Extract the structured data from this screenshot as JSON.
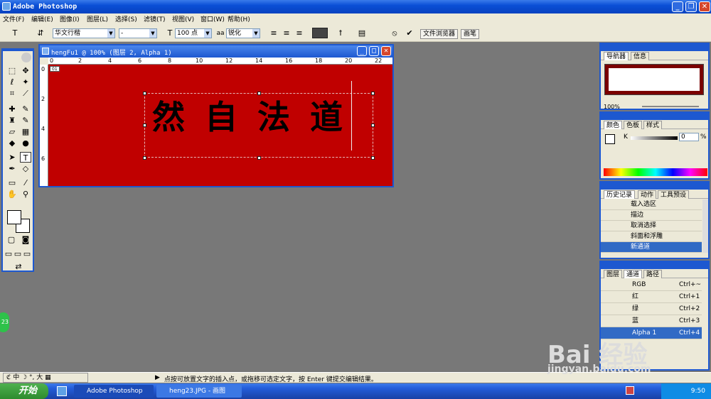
{
  "app": {
    "title": "Adobe Photoshop"
  },
  "menu": [
    "文件(F)",
    "编辑(E)",
    "图像(I)",
    "图层(L)",
    "选择(S)",
    "滤镜(T)",
    "视图(V)",
    "窗口(W)",
    "帮助(H)"
  ],
  "options": {
    "font_family": "华文行楷",
    "font_style": "-",
    "font_size": "100 点",
    "antialias_label": "aa",
    "antialias": "锐化",
    "wells": [
      "文件浏览器",
      "画笔"
    ]
  },
  "document": {
    "title": "hengFu1 @ 100% (图层 2, Alpha 1)",
    "tag": "01",
    "text": "然自法道",
    "ruler_h": [
      "0",
      "2",
      "4",
      "6",
      "8",
      "10",
      "12",
      "14",
      "16",
      "18",
      "20",
      "22"
    ],
    "ruler_v": [
      "0",
      "2",
      "4",
      "6"
    ]
  },
  "navigator": {
    "tabs": [
      "导航器",
      "信息"
    ],
    "zoom": "100%"
  },
  "color": {
    "tabs": [
      "颜色",
      "色板",
      "样式"
    ],
    "channel": "K",
    "value": "0",
    "unit": "%"
  },
  "history": {
    "tabs": [
      "历史记录",
      "动作",
      "工具预设"
    ],
    "items": [
      {
        "label": "载入选区"
      },
      {
        "label": "描边"
      },
      {
        "label": "取消选择"
      },
      {
        "label": "斜面和浮雕"
      },
      {
        "label": "新通道"
      }
    ]
  },
  "channels": {
    "tabs": [
      "图层",
      "通道",
      "路径"
    ],
    "items": [
      {
        "name": "RGB",
        "shortcut": "Ctrl+~"
      },
      {
        "name": "红",
        "shortcut": "Ctrl+1"
      },
      {
        "name": "绿",
        "shortcut": "Ctrl+2"
      },
      {
        "name": "蓝",
        "shortcut": "Ctrl+3"
      },
      {
        "name": "Alpha 1",
        "shortcut": "Ctrl+4"
      }
    ]
  },
  "status": {
    "text": "点按可放置文字的插入点，或拖移可选定文字，按 Enter 键提交编辑结果。",
    "ime": "中",
    "ime_extra": "大",
    "left_label": "23"
  },
  "taskbar": {
    "start": "开始",
    "tasks": [
      "Adobe Photoshop",
      "heng23.JPG - 画图"
    ],
    "time": "9:50"
  },
  "watermark": {
    "logo": "Bai  经验",
    "url": "jingyan.baidu.com"
  },
  "colors": {
    "canvas": "#c00000",
    "titlebar": "#0a4fd6",
    "selection": "#316ac5"
  }
}
